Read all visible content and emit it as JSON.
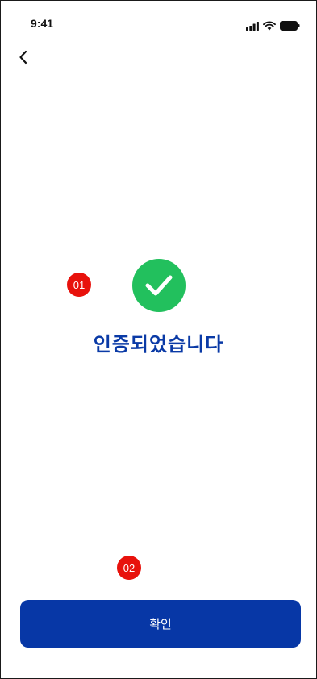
{
  "status_bar": {
    "time": "9:41",
    "icons": [
      "signal-icon",
      "wifi-icon",
      "battery-icon"
    ]
  },
  "header": {
    "back_icon": "chevron-left-icon"
  },
  "annotations": {
    "badge_1": "01",
    "badge_2": "02"
  },
  "main": {
    "status_icon": "check-circle-icon",
    "title": "인증되었습니다"
  },
  "footer": {
    "confirm_label": "확인"
  },
  "colors": {
    "accent": "#0737a6",
    "title": "#0a3aa6",
    "success": "#22c05d",
    "badge": "#e8120c"
  }
}
